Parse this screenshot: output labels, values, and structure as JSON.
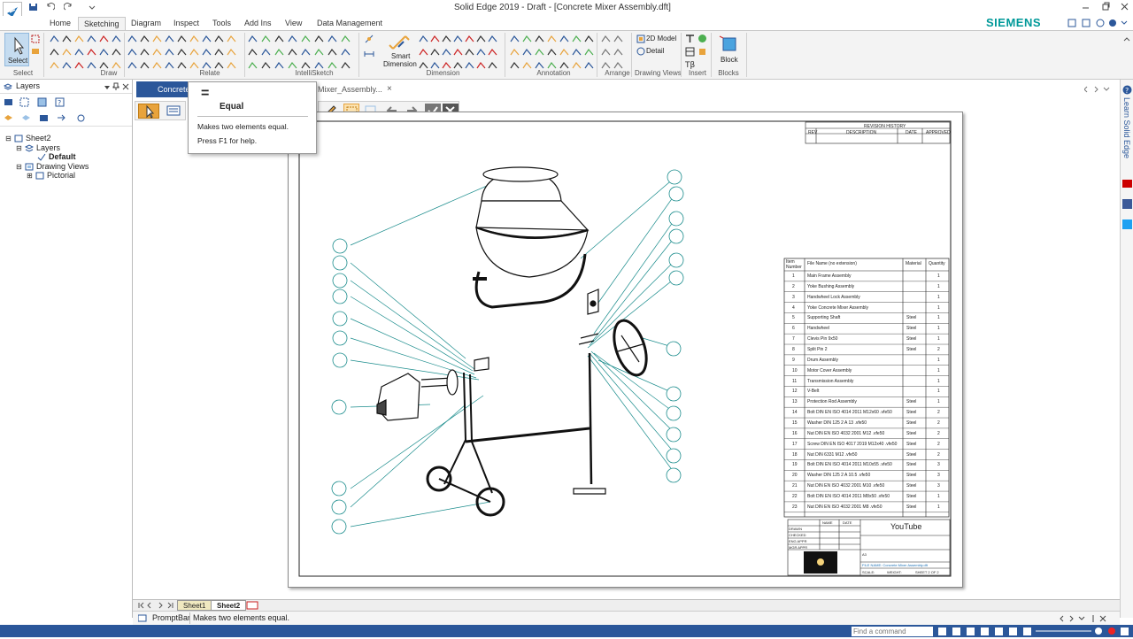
{
  "titlebar": {
    "title": "Solid Edge 2019 - Draft - [Concrete Mixer Assembly.dft]",
    "brand": "SIEMENS"
  },
  "ribbon_tabs": [
    "Home",
    "Sketching",
    "Diagram",
    "Inspect",
    "Tools",
    "Add Ins",
    "View",
    "Data Management"
  ],
  "ribbon": {
    "select_label": "Select",
    "groups": {
      "select": "Select",
      "draw": "Draw",
      "relate": "Relate",
      "intellisketch": "IntelliSketch",
      "dimension": "Dimension",
      "annotation": "Annotation",
      "arrange": "Arrange",
      "drawing_views": "Drawing Views",
      "insert": "Insert",
      "blocks": "Blocks"
    },
    "smart_dimension_1": "Smart",
    "smart_dimension_2": "Dimension",
    "model_2d": "2D Model",
    "detail": "Detail",
    "block": "Block"
  },
  "left_pane": {
    "title": "Layers",
    "tree": {
      "sheet": "Sheet2",
      "layers": "Layers",
      "default": "Default",
      "drawing_views": "Drawing Views",
      "pictorial": "Pictorial"
    }
  },
  "doc_tabs": {
    "active": "Concrete",
    "second": "Mixer_Assembly...",
    "close": "×"
  },
  "tooltip": {
    "icon": "=",
    "title": "Equal",
    "desc": "Makes two elements equal.",
    "help": "Press F1 for help."
  },
  "revision_history": {
    "title": "REVISION HISTORY",
    "cols": [
      "REV",
      "DESCRIPTION",
      "DATE",
      "APPROVED"
    ]
  },
  "bom": {
    "headers": [
      "Item Number",
      "File Name (no extension)",
      "Material",
      "Quantity"
    ],
    "rows": [
      [
        "1",
        "Main Frame Assembly",
        "",
        "1"
      ],
      [
        "2",
        "Yoke Bushing Assembly",
        "",
        "1"
      ],
      [
        "3",
        "Handwheel Lock Assembly",
        "",
        "1"
      ],
      [
        "4",
        "Yoke Concrete Mixer Assembly",
        "",
        "1"
      ],
      [
        "5",
        "Supporting Shaft",
        "Steel",
        "1"
      ],
      [
        "6",
        "Handwheel",
        "Steel",
        "1"
      ],
      [
        "7",
        "Clevis Pin 9x50",
        "Steel",
        "1"
      ],
      [
        "8",
        "Split Pin 2",
        "Steel",
        "2"
      ],
      [
        "9",
        "Drum Assembly",
        "",
        "1"
      ],
      [
        "10",
        "Motor Cover Assembly",
        "",
        "1"
      ],
      [
        "11",
        "Transmission Assembly",
        "",
        "1"
      ],
      [
        "12",
        "V-Belt",
        "",
        "1"
      ],
      [
        "13",
        "Protection Rod Assembly",
        "Steel",
        "1"
      ],
      [
        "14",
        "Bolt DIN EN ISO 4014 2011 M12x60 .vfe50",
        "Steel",
        "2"
      ],
      [
        "15",
        "Washer DIN 125 2 A 13 .vfe50",
        "Steel",
        "2"
      ],
      [
        "16",
        "Nut DIN EN ISO 4032 2001 M12 .vfe50",
        "Steel",
        "2"
      ],
      [
        "17",
        "Screw DIN EN ISO 4017 2019 M12x40 .vfe50",
        "Steel",
        "2"
      ],
      [
        "18",
        "Nut DIN 6331 M12 .vfe50",
        "Steel",
        "2"
      ],
      [
        "19",
        "Bolt DIN EN ISO 4014 2011 M10x55 .vfe50",
        "Steel",
        "3"
      ],
      [
        "20",
        "Washer DIN 125 2 A 10.5 .vfe50",
        "Steel",
        "3"
      ],
      [
        "21",
        "Nut DIN EN ISO 4032 2001 M10 .vfe50",
        "Steel",
        "3"
      ],
      [
        "22",
        "Bolt DIN EN ISO 4014 2011 M8x50 .vfe50",
        "Steel",
        "1"
      ],
      [
        "23",
        "Nut DIN EN ISO 4032 2001 M8 .vfe50",
        "Steel",
        "1"
      ]
    ]
  },
  "title_block": {
    "youtube": "YouTube",
    "labels": [
      "DRAWN",
      "CHECKED",
      "ENG APPR",
      "MGR APPR"
    ],
    "name": "NAME",
    "date": "DATE",
    "file_name": "FILE NAME: Concrete Mixer Assembly.dft",
    "sheet": "SHEET 2 OF 2",
    "scale": "SCALE:",
    "weight": "WEIGHT:",
    "size": "A3"
  },
  "sheet_tabs": [
    "Sheet1",
    "Sheet2"
  ],
  "promptbar": {
    "label": "PromptBar",
    "message": "Makes two elements equal."
  },
  "right_strip": {
    "label": "Learn Solid Edge"
  },
  "statusbar": {
    "find_placeholder": "Find a command"
  }
}
